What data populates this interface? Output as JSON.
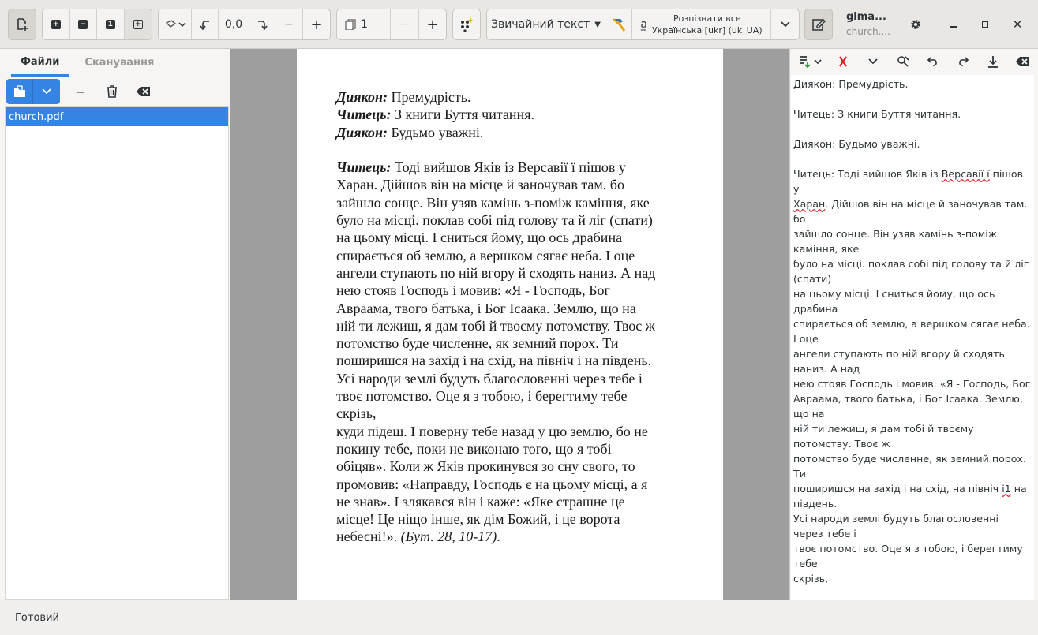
{
  "headerbar": {
    "rotation_value": "0,0",
    "page_value": "1",
    "output_mode": "Звичайний текст",
    "recognize_label": "Розпізнати все",
    "language_label": "Українська [ukr] (uk_UA)",
    "title": "glma...",
    "subtitle": "church...."
  },
  "sidebar": {
    "tabs": [
      "Файли",
      "Сканування"
    ],
    "files": [
      "church.pdf"
    ]
  },
  "document": {
    "lines": [
      {
        "speaker": "Диякон:",
        "text": " Премудрість."
      },
      {
        "speaker": "Читець:",
        "text": " З книги Буття читання."
      },
      {
        "speaker": "Диякон:",
        "text": " Будьмо уважні."
      },
      {
        "speaker": "",
        "text": ""
      },
      {
        "speaker": "Читець:",
        "text": " Тоді вийшов Яків із Версавії ї пішов у"
      },
      {
        "speaker": "",
        "text": "Харан. Дійшов він на місце й заночував там. бо"
      },
      {
        "speaker": "",
        "text": "зайшло сонце. Він узяв камінь з-поміж каміння, яке"
      },
      {
        "speaker": "",
        "text": "було на місці. поклав собі під голову та й ліг (спати)"
      },
      {
        "speaker": "",
        "text": "на цьому місці. І сниться йому, що ось драбина"
      },
      {
        "speaker": "",
        "text": "спирається об землю, а вершком сягає неба. І оце"
      },
      {
        "speaker": "",
        "text": "ангели ступають по ній вгору й сходять наниз. А над"
      },
      {
        "speaker": "",
        "text": "нею стояв Господь і мовив: «Я - Господь, Бог"
      },
      {
        "speaker": "",
        "text": "Авраама, твого батька, і Бог Ісаака. Землю, що на"
      },
      {
        "speaker": "",
        "text": "ній ти лежиш, я дам тобі й твоєму потомству. Твоє ж"
      },
      {
        "speaker": "",
        "text": "потомство буде численне, як земний порох. Ти"
      },
      {
        "speaker": "",
        "text": "поширишся на захід і на схід, на північ і на південь."
      },
      {
        "speaker": "",
        "text": "Усі народи землі будуть благословенні через тебе і"
      },
      {
        "speaker": "",
        "text": "твоє потомство. Оце я з тобою, і берегтиму тебе"
      },
      {
        "speaker": "",
        "text": "скрізь,"
      },
      {
        "speaker": "",
        "text": "куди підеш. І поверну тебе назад у цю землю, бо не"
      },
      {
        "speaker": "",
        "text": "покину тебе, поки не виконаю того, що я тобі"
      },
      {
        "speaker": "",
        "text": "обіцяв». Коли ж Яків прокинувся зо сну свого, то"
      },
      {
        "speaker": "",
        "text": "промовив: «Направду, Господь є на цьому місці, а я"
      },
      {
        "speaker": "",
        "text": "не знав». І злякався він і каже: «Яке страшне це"
      },
      {
        "speaker": "",
        "text": "місце! Це ніщо інше, як дім Божий, і це ворота"
      }
    ],
    "last_line_text": "небесні!». ",
    "last_line_ref": "(Бут. 28, 10-17)",
    "last_line_end": "."
  },
  "output_text": {
    "lines": [
      "Диякон: Премудрість.",
      "",
      "Читець: З книги Буття читання.",
      "",
      "Диякон: Будьмо уважні.",
      "",
      "Читець: Тоді вийшов Яків із Версавії ї пішов",
      "у",
      "Харан. Дійшов він на місце й заночував там.",
      "бо",
      "зайшло сонце. Він узяв камінь з-поміж",
      "каміння, яке",
      "було на місці. поклав собі під голову та й ліг",
      "(спати)",
      "на цьому місці. І сниться йому, що ось",
      "драбина",
      "спирається об землю, а вершком сягає неба.",
      "І оце",
      "ангели ступають по ній вгору й сходять",
      "наниз. А над",
      "нею стояв Господь і мовив: «Я - Господь, Бог",
      "Авраама, твого батька, і Бог Ісаака. Землю,",
      "що на",
      "ній ти лежиш, я дам тобі й твоєму",
      "потомству. Твоє ж",
      "потомство буде численне, як земний порох.",
      "Ти",
      "поширишся на захід і на схід, на північ і1 на",
      "південь.",
      "Усі народи землі будуть благословенні",
      "через тебе і",
      "твоє потомство. Оце я з тобою, і берегтиму",
      "тебе",
      "скрізь,"
    ]
  },
  "statusbar": {
    "text": "Готовий"
  },
  "colors": {
    "accent": "#3584e4",
    "doc_background": "#9e9e9e",
    "spell_underline": "#e01b24"
  }
}
